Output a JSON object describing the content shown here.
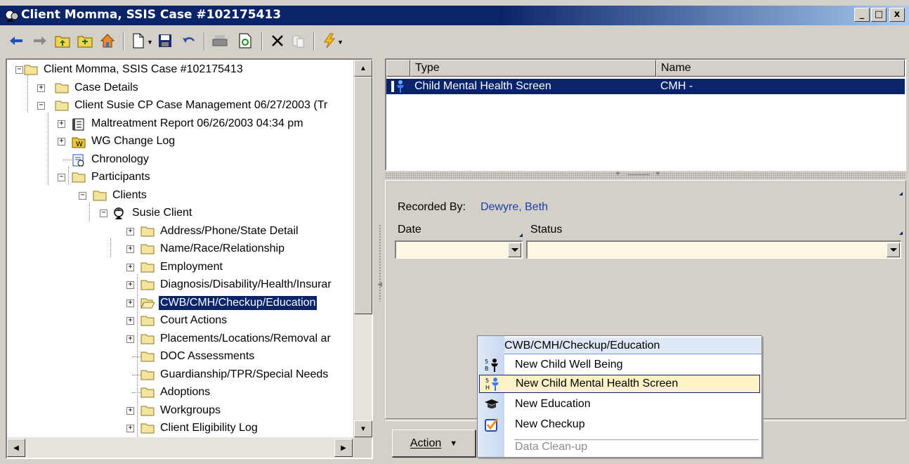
{
  "window": {
    "title": "Client Momma, SSIS Case #102175413",
    "controls": [
      "_",
      "□",
      "x"
    ]
  },
  "toolbar": {
    "buttons": [
      "back-icon",
      "forward-icon",
      "folder-up-icon",
      "folder-open-icon",
      "home-icon",
      "new-document-icon",
      "save-icon",
      "undo-icon",
      "print-icon",
      "refresh-icon",
      "delete-icon",
      "copy-icon",
      "lightning-icon"
    ]
  },
  "tree": {
    "items": [
      {
        "label": "Client Momma, SSIS Case #102175413",
        "icon": "folder-icon"
      },
      {
        "label": "Case Details",
        "icon": "folder-icon"
      },
      {
        "label": "Client Susie CP Case Management 06/27/2003 (Tr",
        "icon": "folder-icon"
      },
      {
        "label": "Maltreatment Report 06/26/2003 04:34 pm",
        "icon": "report-icon"
      },
      {
        "label": "WG Change Log",
        "icon": "change-log-icon"
      },
      {
        "label": "Chronology",
        "icon": "chronology-icon"
      },
      {
        "label": "Participants",
        "icon": "folder-icon"
      },
      {
        "label": "Clients",
        "icon": "folder-icon"
      },
      {
        "label": "Susie Client",
        "icon": "person-icon"
      },
      {
        "label": "Address/Phone/State Detail",
        "icon": "folder-icon"
      },
      {
        "label": "Name/Race/Relationship",
        "icon": "folder-icon"
      },
      {
        "label": "Employment",
        "icon": "folder-icon"
      },
      {
        "label": "Diagnosis/Disability/Health/Insurar",
        "icon": "folder-icon"
      },
      {
        "label": "CWB/CMH/Checkup/Education",
        "icon": "folder-open-icon"
      },
      {
        "label": "Court Actions",
        "icon": "folder-icon"
      },
      {
        "label": "Placements/Locations/Removal ar",
        "icon": "folder-icon"
      },
      {
        "label": "DOC Assessments",
        "icon": "folder-icon"
      },
      {
        "label": "Guardianship/TPR/Special Needs",
        "icon": "folder-icon"
      },
      {
        "label": "Adoptions",
        "icon": "folder-icon"
      },
      {
        "label": "Workgroups",
        "icon": "folder-icon"
      },
      {
        "label": "Client Eligibility Log",
        "icon": "folder-icon"
      }
    ]
  },
  "list": {
    "columns": [
      "Type",
      "Name"
    ],
    "rows": [
      {
        "type": "Child Mental Health Screen",
        "name": "CMH -"
      }
    ]
  },
  "detail": {
    "recorded_by_label": "Recorded By:",
    "recorded_by_value": "Dewyre, Beth",
    "date_label": "Date",
    "status_label": "Status",
    "date_value": "",
    "status_value": ""
  },
  "action": {
    "label": "Action",
    "arrow": "▼"
  },
  "popup": {
    "title": "CWB/CMH/Checkup/Education",
    "items": [
      {
        "label": "New Child Well Being",
        "icon": "child-well-being-icon"
      },
      {
        "label": "New Child Mental Health Screen",
        "icon": "child-mental-health-icon"
      },
      {
        "label": "New Education",
        "icon": "graduation-cap-icon"
      },
      {
        "label": "New Checkup",
        "icon": "checkup-icon"
      },
      {
        "label": "Data Clean-up",
        "icon": ""
      }
    ]
  },
  "colors": {
    "titlebar": "#0a246a",
    "selection": "#0a246a",
    "link": "#1a3fa8",
    "field_bg": "#fdf8e1",
    "menu_highlight": "#fdf1c6",
    "folder": "#f4e49c"
  }
}
